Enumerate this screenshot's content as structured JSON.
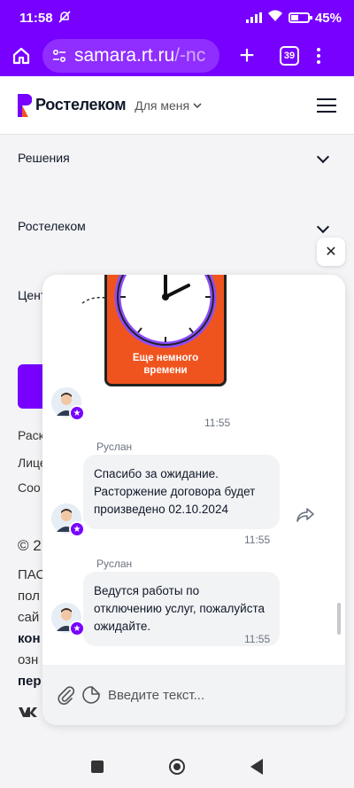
{
  "status_bar": {
    "time": "11:58",
    "battery": "45%"
  },
  "browser": {
    "url_host": "samara.rt.ru",
    "url_path": "/-nc",
    "tab_count": "39"
  },
  "site_header": {
    "logo_text": "Ростелеком",
    "for_me": "Для меня"
  },
  "footer_sections": [
    {
      "label": "Решения"
    },
    {
      "label": "Ростелеком"
    },
    {
      "label": "Цент"
    }
  ],
  "background_fragments": [
    "Раск",
    "Лице",
    "Соо",
    "© 2",
    "ПАС",
    "пол",
    "сай",
    "кон",
    "озн",
    "пер"
  ],
  "chat": {
    "sticker_text_line1": "Еще немного",
    "sticker_text_line2": "времени",
    "messages": [
      {
        "time": "11:55"
      },
      {
        "sender": "Руслан",
        "text": "Спасибо за ожидание. Расторжение договора будет произведено 02.10.2024",
        "time": "11:55"
      },
      {
        "sender": "Руслан",
        "text": "Ведутся работы по отключению услуг, пожалуйста ожидайте.",
        "time": "11:55"
      }
    ],
    "input_placeholder": "Введите текст...",
    "close_label": "✕"
  },
  "colors": {
    "brand": "#7700ff",
    "accent_orange": "#f0541e"
  },
  "icons": [
    "home-icon",
    "tune-icon",
    "plus-icon",
    "tabs-icon",
    "more-icon",
    "hamburger-icon",
    "chevron-down-icon",
    "close-icon",
    "share-icon",
    "attach-icon",
    "sticker-icon"
  ]
}
